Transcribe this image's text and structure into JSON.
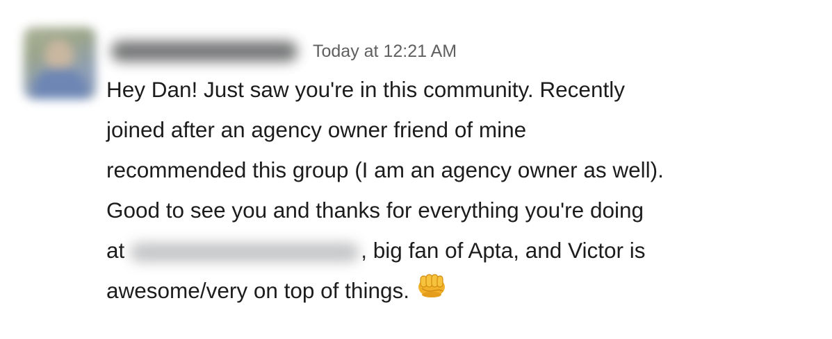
{
  "message": {
    "timestamp": "Today at 12:21 AM",
    "lines": [
      "Hey Dan! Just saw you're in this community. Recently",
      "joined after an agency owner friend of mine",
      "recommended this group (I am an agency owner as well).",
      "Good to see you and thanks for everything you're doing"
    ],
    "line5_before": "at",
    "line5_after": ", big fan of Apta, and Victor is",
    "line6": "awesome/very on top of things.",
    "emoji": "oncoming-fist-icon",
    "emoji_color": "#f2b12a"
  }
}
